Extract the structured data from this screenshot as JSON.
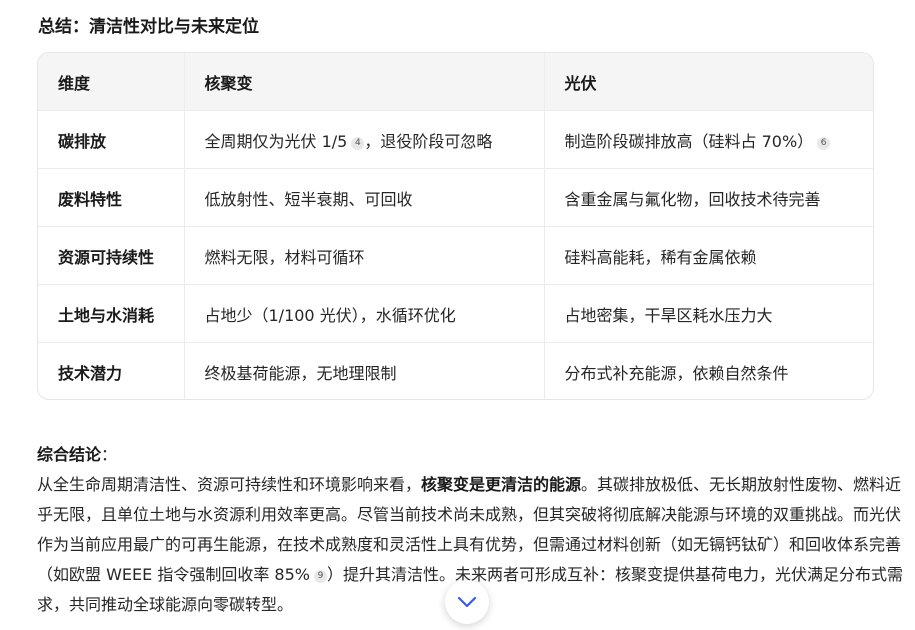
{
  "heading": "总结：清洁性对比与未来定位",
  "table": {
    "headers": [
      "维度",
      "核聚变",
      "光伏"
    ],
    "rows": [
      {
        "dim": "碳排放",
        "fusion": "全周期仅为光伏 1/5",
        "fusion_cite": "4",
        "fusion_after": "，退役阶段可忽略",
        "pv": "制造阶段碳排放高（硅料占 70%）",
        "pv_cite": "6"
      },
      {
        "dim": "废料特性",
        "fusion": "低放射性、短半衰期、可回收",
        "pv": "含重金属与氟化物，回收技术待完善"
      },
      {
        "dim": "资源可持续性",
        "fusion": "燃料无限，材料可循环",
        "pv": "硅料高能耗，稀有金属依赖"
      },
      {
        "dim": "土地与水消耗",
        "fusion": "占地少（1/100 光伏），水循环优化",
        "pv": "占地密集，干旱区耗水压力大"
      },
      {
        "dim": "技术潜力",
        "fusion": "终极基荷能源，无地理限制",
        "pv": "分布式补充能源，依赖自然条件"
      }
    ]
  },
  "conclusion": {
    "label": "综合结论",
    "colon": "：",
    "part1": "从全生命周期清洁性、资源可持续性和环境影响来看，",
    "bold": "核聚变是更清洁的能源",
    "part2": "。其碳排放极低、无长期放射性废物、燃料近乎无限，且单位土地与水资源利用效率更高。尽管当前技术尚未成熟，但其突破将彻底解决能源与环境的双重挑战。而光伏作为当前应用最广的可再生能源，在技术成熟度和灵活性上具有优势，但需通过材料创新（如无镉钙钛矿）和回收体系完善（如欧盟 WEEE 指令强制回收率 85%",
    "cite": "9",
    "part3": "）提升其清洁性。未来两者可形成互补：核聚变提供基荷电力，光伏满足分布式需求，共同推动全球能源向零碳转型。"
  },
  "icons": {
    "scroll_down": "chevron-down-icon"
  },
  "colors": {
    "accent": "#3b5bdb"
  }
}
